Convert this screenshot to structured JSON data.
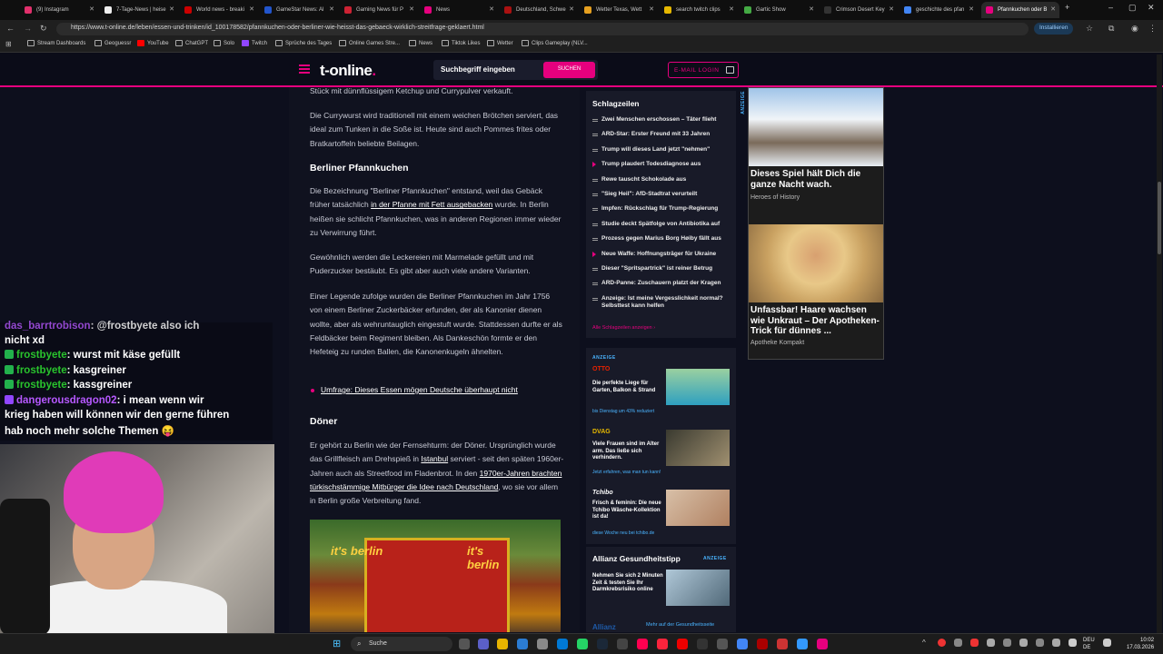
{
  "tabs": [
    {
      "label": "(9) Instagram",
      "color": "#e1306c"
    },
    {
      "label": "7-Tage-News | heise",
      "color": "#eeeeee"
    },
    {
      "label": "World news - breaki",
      "color": "#cc0000"
    },
    {
      "label": "GameStar News: Al",
      "color": "#2255cc"
    },
    {
      "label": "Gaming News für P",
      "color": "#cc2233"
    },
    {
      "label": "News",
      "color": "#e6007e"
    },
    {
      "label": "Deutschland, Schwe",
      "color": "#aa1111"
    },
    {
      "label": "Wetter Texas, Wett",
      "color": "#e6a020"
    },
    {
      "label": "search twitch clips",
      "color": "#e6b800"
    },
    {
      "label": "Gartic Show",
      "color": "#44aa44"
    },
    {
      "label": "Crimson Desert Key",
      "color": "#222222"
    },
    {
      "label": "geschichte des pfan",
      "color": "#4285f4"
    },
    {
      "label": "Pfannkuchen oder B",
      "color": "#e6007e"
    }
  ],
  "url": "https://www.t-online.de/leben/essen-und-trinken/id_100178582/pfannkuchen-oder-berliner-wie-heisst-das-gebaeck-wirklich-streitfrage-geklaert.html",
  "install_label": "Installieren",
  "bookmarks": [
    "Stream Dashboards",
    "Geoguessr",
    "YouTube",
    "ChatGPT",
    "Solo",
    "Twitch",
    "Sprüche des Tages",
    "Online Games Stre...",
    "News",
    "Tiktok Likes",
    "Wetter",
    "Clips Gameplay (NLV..."
  ],
  "header": {
    "logo": "t-online",
    "logo_dot": ".",
    "search_placeholder": "Suchbegriff eingeben",
    "search_button": "SUCHEN",
    "login": "E-MAIL LOGIN"
  },
  "article": {
    "p0": "Stück mit dünnflüssigem Ketchup und Currypulver verkauft.",
    "p1": "Die Currywurst wird traditionell mit einem weichen Brötchen serviert, das ideal zum Tunken in die Soße ist. Heute sind auch Pommes frites oder Bratkartoffeln beliebte Beilagen.",
    "h1": "Berliner Pfannkuchen",
    "p2a": "Die Bezeichnung \"Berliner Pfannkuchen\" entstand, weil das Gebäck früher tatsächlich ",
    "p2link": "in der Pfanne mit Fett ausgebacken",
    "p2b": " wurde. In Berlin heißen sie schlicht Pfannkuchen, was in anderen Regionen immer wieder zu Verwirrung führt.",
    "p3": "Gewöhnlich werden die Leckereien mit Marmelade gefüllt und mit Puderzucker bestäubt. Es gibt aber auch viele andere Varianten.",
    "p4": "Einer Legende zufolge wurden die Berliner Pfannkuchen im Jahr 1756 von einem Berliner Zuckerbäcker erfunden, der als Kanonier dienen wollte, aber als wehruntauglich eingestuft wurde. Stattdessen durfte er als Feldbäcker beim Regiment bleiben. Als Dankeschön formte er den Hefeteig zu runden Ballen, die Kanonenkugeln ähnelten.",
    "bullet": "Umfrage: Dieses Essen mögen Deutsche überhaupt nicht",
    "h2": "Döner",
    "p5a": "Er gehört zu Berlin wie der Fernsehturm: der Döner. Ursprünglich wurde das Grillfleisch am Drehspieß in ",
    "p5link1": "Istanbul",
    "p5b": " serviert - seit den späten 1960er-Jahren auch als Streetfood im Fladenbrot. In den ",
    "p5link2": "1970er-Jahren brachten türkischstämmige Mitbürger die Idee nach Deutschland",
    "p5c": ", wo sie vor allem in Berlin große Verbreitung fand.",
    "img_text": "it's berlin"
  },
  "schlagzeilen": {
    "title": "Schlagzeilen",
    "items": [
      "Zwei Menschen erschossen – Täter flieht",
      "ARD-Star: Erster Freund mit 33 Jahren",
      "Trump will dieses Land jetzt \"nehmen\"",
      "Trump plaudert Todesdiagnose aus",
      "Rewe tauscht Schokolade aus",
      "\"Sieg Heil\": AfD-Stadtrat verurteilt",
      "Impfen: Rückschlag für Trump-Regierung",
      "Studie deckt Spätfolge von Antibiotika auf",
      "Prozess gegen Marius Borg Høiby fällt aus",
      "Neue Waffe: Hoffnungsträger für Ukraine",
      "Dieser \"Spritspartrick\" ist reiner Betrug",
      "ARD-Panne: Zuschauern platzt der Kragen",
      "Anzeige: Ist meine Vergesslichkeit normal? Selbsttest kann helfen"
    ],
    "more": "Alle Schlagzeilen anzeigen"
  },
  "ads": {
    "label": "ANZEIGE",
    "a1_brand": "OTTO",
    "a1_text": "Die perfekte Liege für Garten, Balkon & Strand",
    "a1_link": "bis Dienstag um 43% reduziert",
    "a2_brand": "DVAG",
    "a2_text": "Viele Frauen sind im Alter arm. Das ließe sich verhindern.",
    "a2_link": "Jetzt erfahren, was man tun kann!",
    "a3_brand": "Tchibo",
    "a3_text": "Frisch & feminin: Die neue Tchibo Wäsche-Kollektion ist da!",
    "a3_link": "diese Woche neu bei tchibo.de",
    "allianz_title": "Allianz Gesundheitstipp",
    "allianz_text": "Nehmen Sie sich 2 Minuten Zeit & testen Sie Ihr Darmkrebsrisiko online",
    "allianz_brand": "Allianz",
    "allianz_more": "Mehr auf der Gesundheitsseite"
  },
  "right_ads": {
    "label": "ANZEIGE",
    "r1_title": "Dieses Spiel hält Dich die ganze Nacht wach.",
    "r1_src": "Heroes of History",
    "r2_title": "Unfassbar! Haare wachsen wie Unkraut – Der Apotheken-Trick für dünnes ...",
    "r2_src": "Apotheke Kompakt"
  },
  "chat": [
    {
      "user": "das_barrtrobison",
      "msg": "@frostbyete also ich"
    },
    {
      "user": "",
      "msg": "nicht xd"
    },
    {
      "user": "frostbyete",
      "msg": "wurst mit käse gefüllt"
    },
    {
      "user": "frostbyete",
      "msg": "kasgreiner"
    },
    {
      "user": "frostbyete",
      "msg": "kassgreiner"
    },
    {
      "user": "dangerousdragon02",
      "msg": "i mean wenn wir"
    },
    {
      "user": "",
      "msg": "krieg haben will können wir den gerne führen"
    },
    {
      "user": "",
      "msg": "hab noch mehr solche Themen 😝"
    }
  ],
  "taskbar": {
    "search": "Suche",
    "lang1": "DEU",
    "lang2": "DE",
    "time": "10:02",
    "date": "17.03.2026"
  }
}
